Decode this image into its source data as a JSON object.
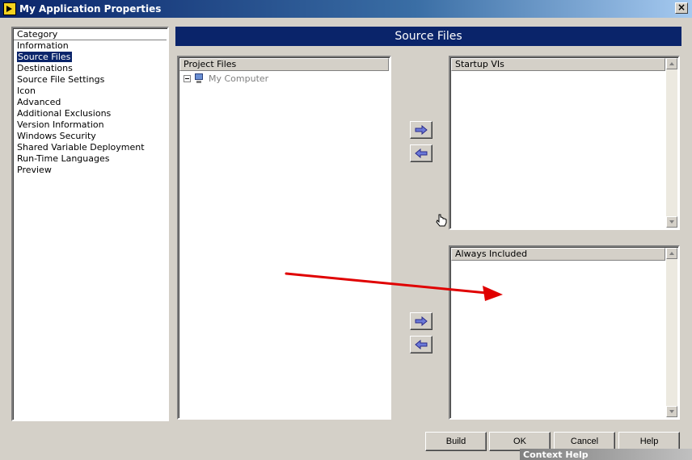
{
  "window": {
    "title": "My Application Properties",
    "close_label": "×"
  },
  "category": {
    "header": "Category",
    "items": [
      {
        "label": "Information"
      },
      {
        "label": "Source Files",
        "selected": true
      },
      {
        "label": "Destinations"
      },
      {
        "label": "Source File Settings"
      },
      {
        "label": "Icon"
      },
      {
        "label": "Advanced"
      },
      {
        "label": "Additional Exclusions"
      },
      {
        "label": "Version Information"
      },
      {
        "label": "Windows Security"
      },
      {
        "label": "Shared Variable Deployment"
      },
      {
        "label": "Run-Time Languages"
      },
      {
        "label": "Preview"
      }
    ]
  },
  "section": {
    "title": "Source Files"
  },
  "project_files": {
    "header": "Project Files",
    "tree_root": "My Computer"
  },
  "startup_vis": {
    "header": "Startup VIs"
  },
  "always_included": {
    "header": "Always Included"
  },
  "buttons": {
    "build": "Build",
    "ok": "OK",
    "cancel": "Cancel",
    "help": "Help"
  },
  "context_help": {
    "title": "Context Help"
  },
  "colors": {
    "selection": "#0a246a",
    "banner": "#0a246a",
    "arrow_button_fill": "#6b79d8",
    "annotation_arrow": "#e00000"
  },
  "icons": {
    "app": "labview-icon",
    "computer": "computer-icon",
    "add": "right-arrow-icon",
    "remove": "left-arrow-icon",
    "cursor": "hand-cursor-icon"
  }
}
